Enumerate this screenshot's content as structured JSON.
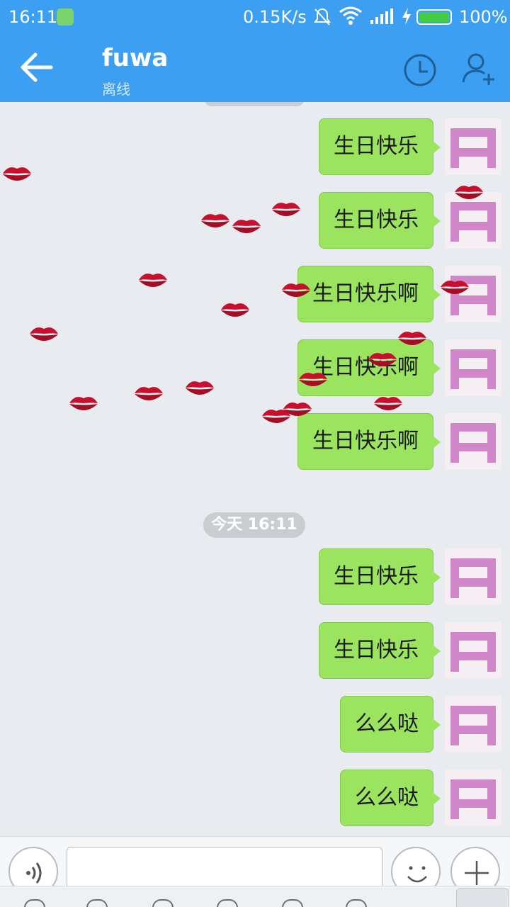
{
  "status_bar": {
    "time": "16:11",
    "net_speed": "0.15K/s",
    "battery_percent": "100%"
  },
  "header": {
    "contact_name": "fuwa",
    "contact_status": "离线"
  },
  "chat": {
    "timestamp": "今天 16:11",
    "messages": [
      {
        "text": "生日快乐"
      },
      {
        "text": "生日快乐"
      },
      {
        "text": "生日快乐啊"
      },
      {
        "text": "生日快乐啊"
      },
      {
        "text": "生日快乐啊"
      },
      {
        "text": "生日快乐"
      },
      {
        "text": "生日快乐"
      },
      {
        "text": "么么哒"
      },
      {
        "text": "么么哒"
      }
    ]
  },
  "input": {
    "value": ""
  },
  "colors": {
    "accent": "#3d9ff2",
    "bubble": "#9be45f",
    "background": "#e8ebef"
  }
}
